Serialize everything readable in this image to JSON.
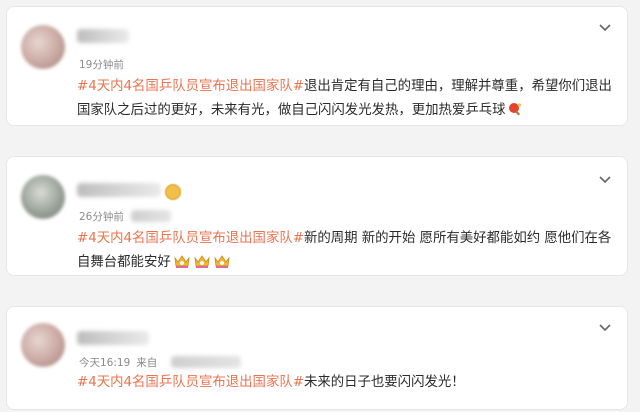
{
  "colors": {
    "hashtag": "#eb7350",
    "background": "#f3f3f3",
    "card": "#ffffff",
    "time": "#8a8a8a"
  },
  "comments": [
    {
      "time": "19分钟前",
      "source": "",
      "hashtag": "#4天内4名国乒队员宣布退出国家队#",
      "body": "退出肯定有自己的理由，理解并尊重，希望你们退出国家队之后过的更好，未来有光，做自己闪闪发光发热，更加热爱乒乓球",
      "emoji": [
        "ping-pong-icon"
      ]
    },
    {
      "time": "26分钟前",
      "source": "",
      "hashtag": "#4天内4名国乒队员宣布退出国家队#",
      "body": "新的周期 新的开始 愿所有美好都能如约 愿他们在各自舞台都能安好",
      "emoji": [
        "crown-cup-icon",
        "crown-cup-icon",
        "crown-cup-icon"
      ]
    },
    {
      "time": "今天16:19",
      "source": "来自",
      "hashtag": "#4天内4名国乒队员宣布退出国家队#",
      "body": "未来的日子也要闪闪发光！",
      "emoji": []
    }
  ]
}
